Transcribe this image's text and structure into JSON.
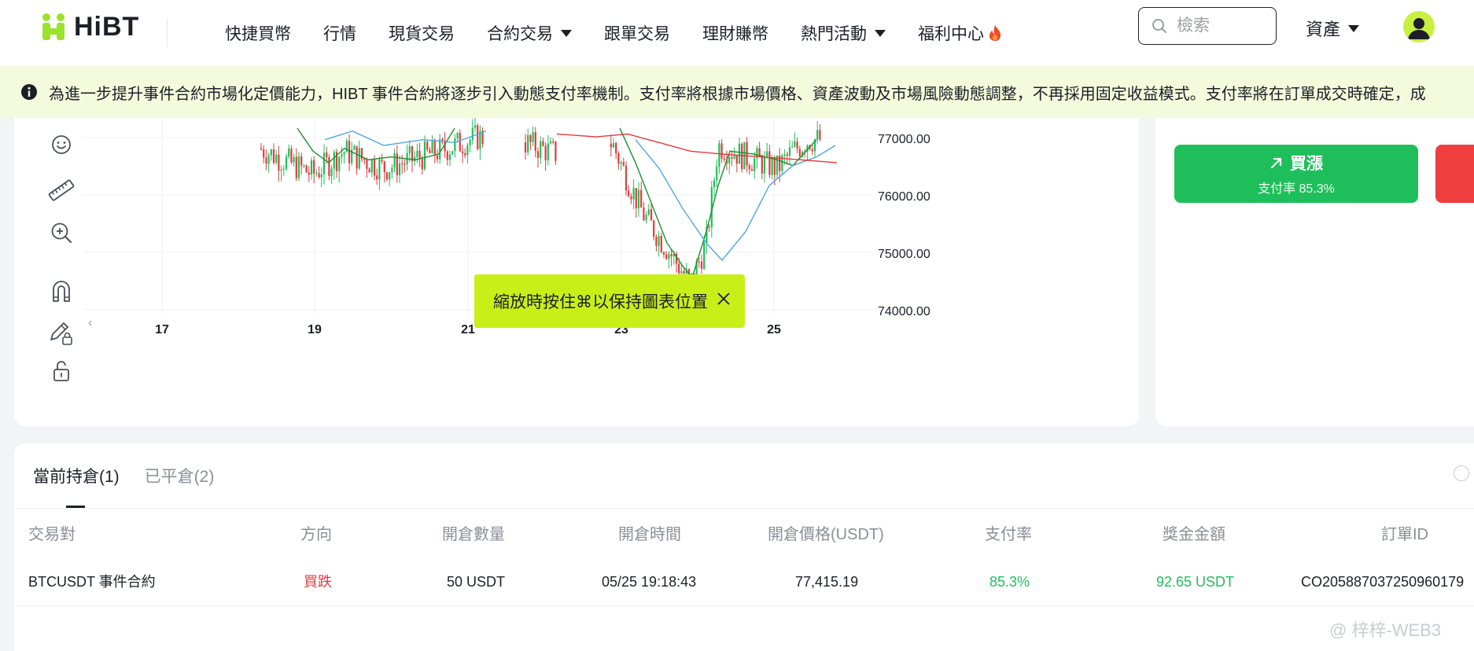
{
  "header": {
    "logo_text": "HiBT",
    "nav": [
      {
        "label": "快捷買幣",
        "has_caret": false
      },
      {
        "label": "行情",
        "has_caret": false
      },
      {
        "label": "現貨交易",
        "has_caret": false
      },
      {
        "label": "合約交易",
        "has_caret": true
      },
      {
        "label": "跟單交易",
        "has_caret": false
      },
      {
        "label": "理財賺幣",
        "has_caret": false
      },
      {
        "label": "熱門活動",
        "has_caret": true
      },
      {
        "label": "福利中心",
        "has_caret": false,
        "icon": "fire-icon"
      }
    ],
    "search_placeholder": "檢索",
    "assets_label": "資產"
  },
  "announcement": {
    "text": "為進一步提升事件合約市場化定價能力，HIBT 事件合約將逐步引入動態支付率機制。支付率將根據市場價格、資產波動及市場風險動態調整，不再採用固定收益模式。支付率將在訂單成交時確定，成"
  },
  "chart": {
    "y_ticks": [
      "77000.00",
      "76000.00",
      "75000.00",
      "74000.00"
    ],
    "x_ticks": [
      "17",
      "19",
      "21",
      "23",
      "25"
    ],
    "colors": {
      "up": "#1ebf5a",
      "down": "#e5393b",
      "ma_short": "#1a8f2e",
      "ma_mid": "#4ea6e8",
      "ma_long": "#e5393b"
    },
    "tools": [
      "smiley-icon",
      "ruler-icon",
      "zoom-in-icon",
      "magnet-icon",
      "pencil-lock-icon",
      "unlock-icon"
    ]
  },
  "toast": {
    "text": "縮放時按住⌘以保持圖表位置"
  },
  "trade": {
    "buy_up_label": "買漲",
    "buy_up_rate": "支付率 85.3%"
  },
  "positions": {
    "tabs": [
      {
        "label": "當前持倉(1)",
        "active": true
      },
      {
        "label": "已平倉(2)",
        "active": false
      }
    ],
    "columns": [
      "交易對",
      "方向",
      "開倉數量",
      "開倉時間",
      "開倉價格(USDT)",
      "支付率",
      "獎金金額",
      "訂單ID"
    ],
    "rows": [
      {
        "pair": "BTCUSDT 事件合約",
        "direction": "買跌",
        "amount": "50 USDT",
        "time": "05/25 19:18:43",
        "price": "77,415.19",
        "rate": "85.3%",
        "bonus": "92.65 USDT",
        "order_id": "CO205887037250960179"
      }
    ]
  },
  "watermark": "@ 梓梓-WEB3"
}
